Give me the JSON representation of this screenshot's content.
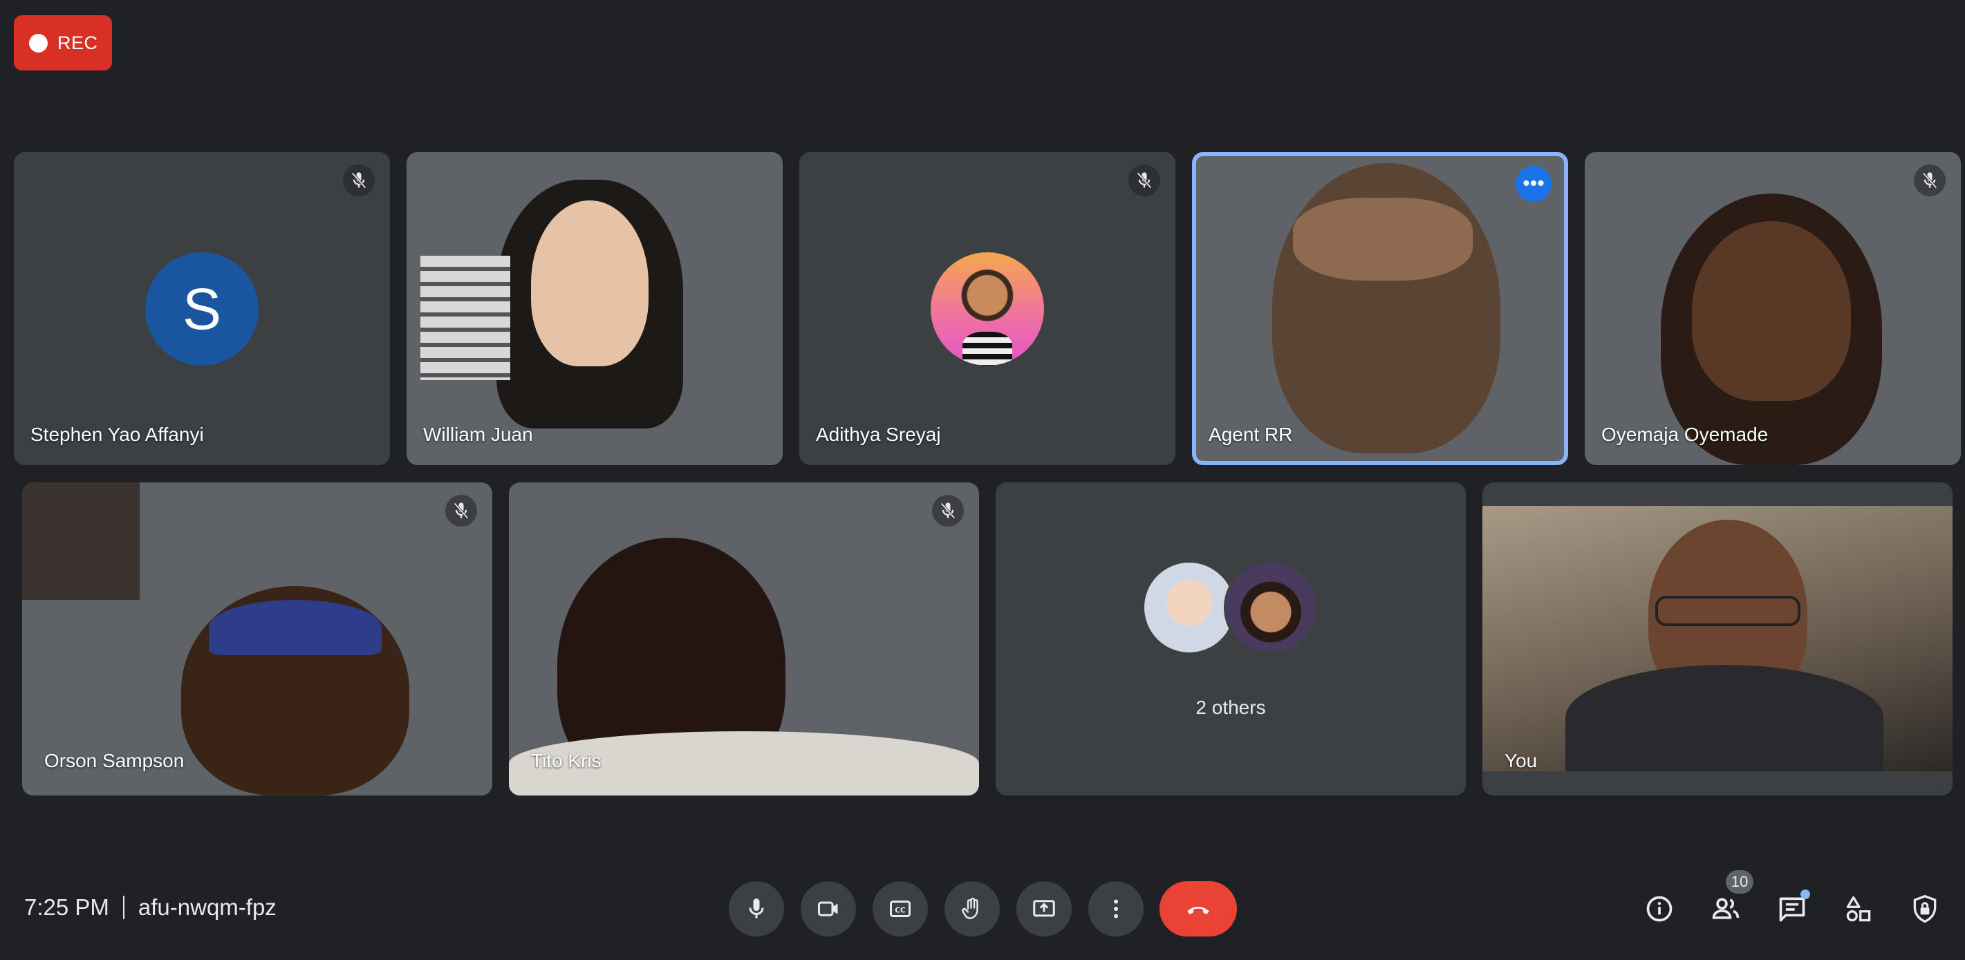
{
  "recording": {
    "label": "REC"
  },
  "participants": [
    {
      "name": "Stephen Yao Affanyi",
      "avatar_letter": "S",
      "muted": true
    },
    {
      "name": "William Juan",
      "muted": false
    },
    {
      "name": "Adithya Sreyaj",
      "muted": true
    },
    {
      "name": "Agent RR",
      "muted": false,
      "speaking_highlight": true
    },
    {
      "name": "Oyemaja Oyemade",
      "muted": true
    },
    {
      "name": "Orson Sampson",
      "muted": true
    },
    {
      "name": "Tito Kris",
      "muted": true
    },
    {
      "name": "You",
      "muted": false
    }
  ],
  "others_tile": {
    "label": "2 others"
  },
  "meeting": {
    "time": "7:25 PM",
    "code": "afu-nwqm-fpz"
  },
  "people_count": "10",
  "colors": {
    "background": "#202124",
    "tile": "#3c4043",
    "accent": "#8ab4f8",
    "hangup": "#ea4335",
    "rec": "#d93025"
  },
  "controls": [
    {
      "icon": "microphone-icon"
    },
    {
      "icon": "camera-icon"
    },
    {
      "icon": "captions-icon"
    },
    {
      "icon": "raise-hand-icon"
    },
    {
      "icon": "present-screen-icon"
    },
    {
      "icon": "more-options-icon"
    },
    {
      "icon": "hang-up-icon"
    }
  ],
  "right_controls": [
    {
      "icon": "info-icon"
    },
    {
      "icon": "people-icon"
    },
    {
      "icon": "chat-icon"
    },
    {
      "icon": "activities-icon"
    },
    {
      "icon": "host-controls-icon"
    }
  ]
}
